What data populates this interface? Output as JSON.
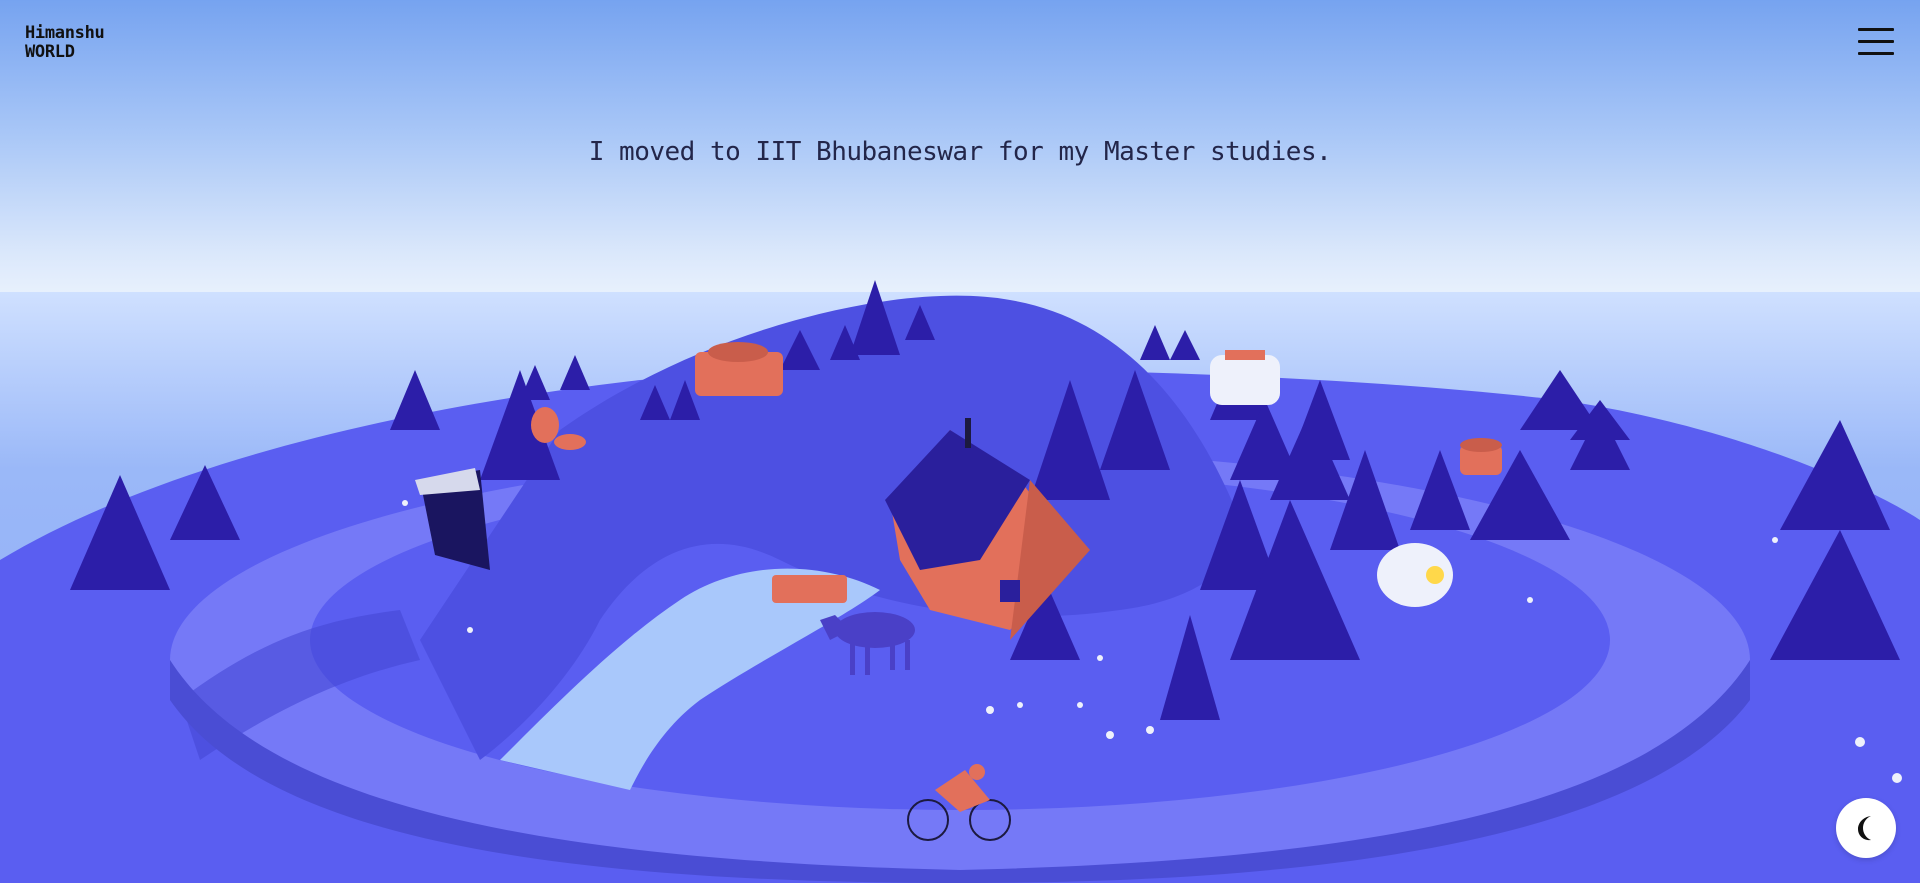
{
  "brand": {
    "line1": "Himanshu",
    "line2": "WORLD"
  },
  "header": {
    "menu_icon": "hamburger-menu-icon"
  },
  "main": {
    "headline": "I moved to IIT Bhubaneswar for my Master studies."
  },
  "controls": {
    "theme_toggle_icon": "moon-icon"
  },
  "colors": {
    "sky_top": "#76a3f0",
    "horizon": "#eaf2fd",
    "ground": "#5b5ef0",
    "path": "#7679f8",
    "tree": "#2c1ea8",
    "accent_orange": "#e2705b"
  }
}
